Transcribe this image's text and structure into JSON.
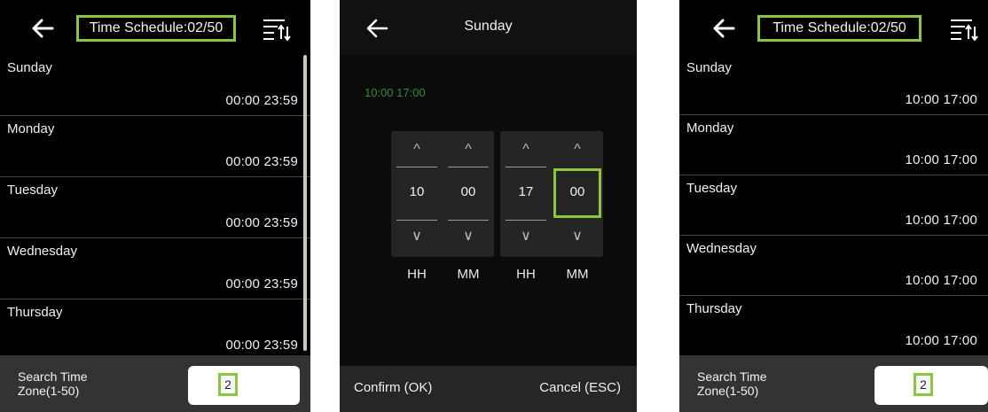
{
  "colors": {
    "accent": "#8cc63f",
    "range_text": "#2e8a3a",
    "background": "#000000"
  },
  "left_screen": {
    "title": "Time Schedule:02/50",
    "back_icon": "arrow-left-icon",
    "sort_icon": "sort-icon",
    "days": [
      {
        "day": "Sunday",
        "time": "00:00  23:59"
      },
      {
        "day": "Monday",
        "time": "00:00  23:59"
      },
      {
        "day": "Tuesday",
        "time": "00:00  23:59"
      },
      {
        "day": "Wednesday",
        "time": "00:00  23:59"
      },
      {
        "day": "Thursday",
        "time": "00:00  23:59"
      }
    ],
    "search": {
      "label_line1": "Search Time",
      "label_line2": "Zone(1-50)",
      "value": "2"
    }
  },
  "middle_screen": {
    "title": "Sunday",
    "range": "10:00  17:00",
    "pickers": [
      {
        "value": "10",
        "unit": "HH"
      },
      {
        "value": "00",
        "unit": "MM"
      },
      {
        "value": "17",
        "unit": "HH"
      },
      {
        "value": "00",
        "unit": "MM"
      }
    ],
    "up_glyph": "^",
    "down_glyph": "∨",
    "confirm": "Confirm (OK)",
    "cancel": "Cancel (ESC)"
  },
  "right_screen": {
    "title": "Time Schedule:02/50",
    "days": [
      {
        "day": "Sunday",
        "time": "10:00  17:00"
      },
      {
        "day": "Monday",
        "time": "10:00  17:00"
      },
      {
        "day": "Tuesday",
        "time": "10:00  17:00"
      },
      {
        "day": "Wednesday",
        "time": "10:00  17:00"
      },
      {
        "day": "Thursday",
        "time": "10:00  17:00"
      }
    ],
    "search": {
      "label_line1": "Search Time",
      "label_line2": "Zone(1-50)",
      "value": "2"
    }
  }
}
